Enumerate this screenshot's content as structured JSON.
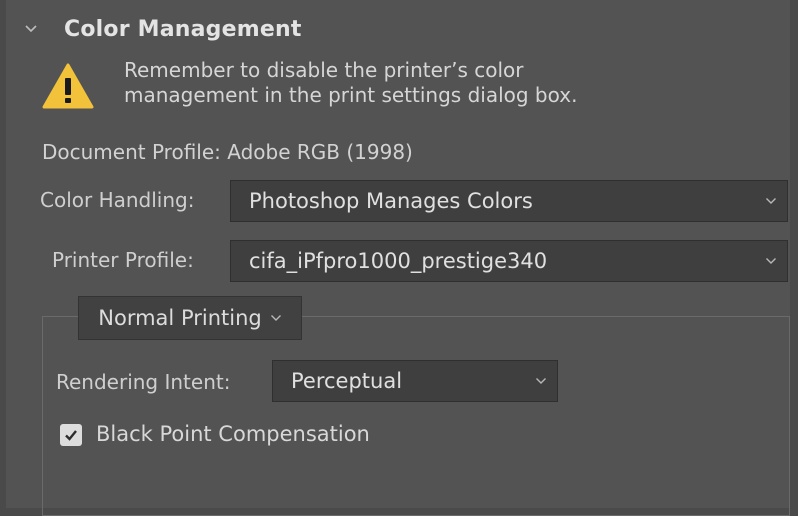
{
  "section": {
    "title": "Color Management",
    "expanded_icon": "chevron-down-icon"
  },
  "warning": {
    "icon": "warning-icon",
    "line1": "Remember to disable the printer’s color",
    "line2": "management in the print settings dialog box."
  },
  "document_profile": "Document Profile: Adobe RGB (1998)",
  "color_handling": {
    "label": "Color Handling:",
    "value": "Photoshop Manages Colors"
  },
  "printer_profile": {
    "label": "Printer Profile:",
    "value": "cifa_iPfpro1000_prestige340"
  },
  "printing_mode": {
    "value": "Normal Printing"
  },
  "rendering_intent": {
    "label": "Rendering Intent:",
    "value": "Perceptual"
  },
  "black_point_compensation": {
    "label": "Black Point Compensation",
    "checked": true
  },
  "colors": {
    "panel_bg": "#535353",
    "field_bg": "#3f3f3f",
    "warning_yellow": "#f2c23a",
    "text": "#d8d8d8"
  }
}
